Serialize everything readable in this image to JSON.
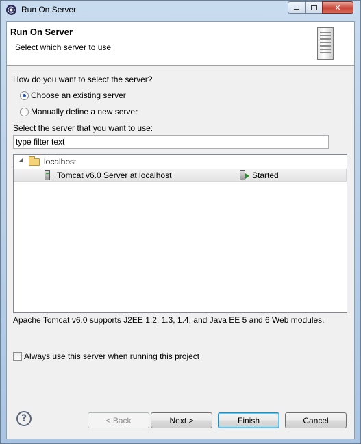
{
  "window": {
    "title": "Run On Server"
  },
  "header": {
    "title": "Run On Server",
    "subtitle": "Select which server to use"
  },
  "selection": {
    "question": "How do you want to select the server?",
    "options": [
      {
        "label": "Choose an existing server",
        "checked": true
      },
      {
        "label": "Manually define a new server",
        "checked": false
      }
    ],
    "list_label": "Select the server that you want to use:"
  },
  "filter": {
    "value": "type filter text"
  },
  "tree": {
    "host": "localhost",
    "server_name": "Tomcat v6.0 Server at localhost",
    "server_state": "Started"
  },
  "description": "Apache Tomcat v6.0 supports J2EE 1.2, 1.3, 1.4, and Java EE 5 and 6 Web modules.",
  "always_use": {
    "label": "Always use this server when running this project",
    "checked": false
  },
  "buttons": {
    "help": "?",
    "back": "< Back",
    "next": "Next >",
    "finish": "Finish",
    "cancel": "Cancel"
  },
  "icons": {
    "app": "eclipse-icon",
    "header": "server-icon",
    "folder": "folder-icon",
    "server": "tomcat-server-icon",
    "state": "server-started-icon",
    "help": "help-icon"
  }
}
